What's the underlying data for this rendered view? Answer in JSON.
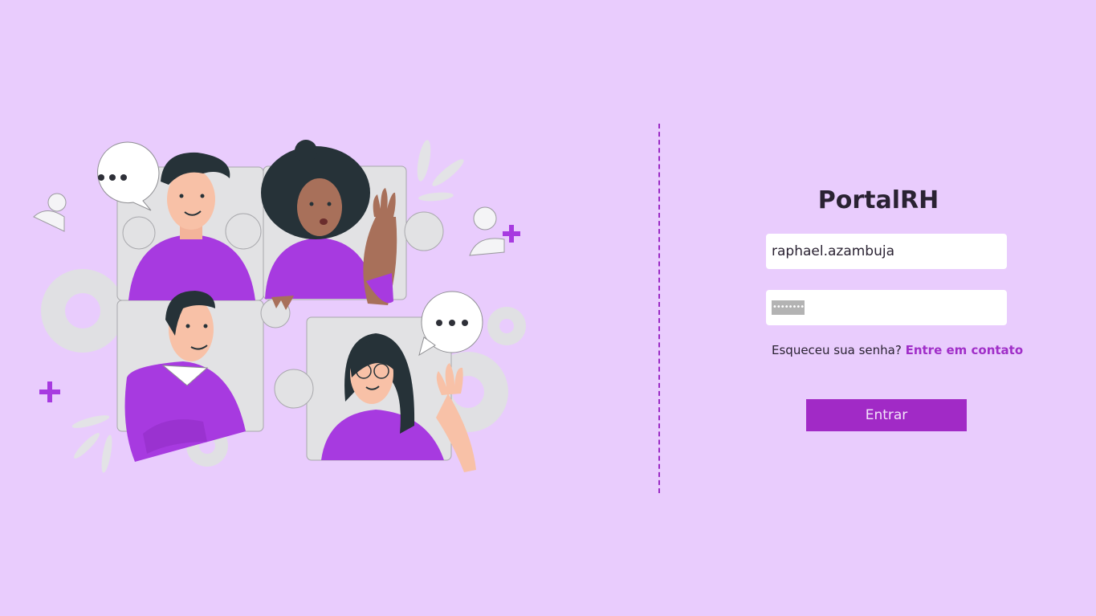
{
  "app": {
    "title": "PortalRH"
  },
  "login": {
    "username_value": "raphael.azambuja",
    "password_mask": "••••••••",
    "forgot_text": "Esqueceu sua senha?",
    "contact_link": "Entre em contato",
    "submit_label": "Entrar"
  },
  "colors": {
    "background": "#e9ccfd",
    "accent": "#a12ac6",
    "shirt": "#a73ae0",
    "puzzle": "#e2e2e4"
  },
  "illustration": {
    "subject": "four-people-puzzle-team-illustration"
  }
}
